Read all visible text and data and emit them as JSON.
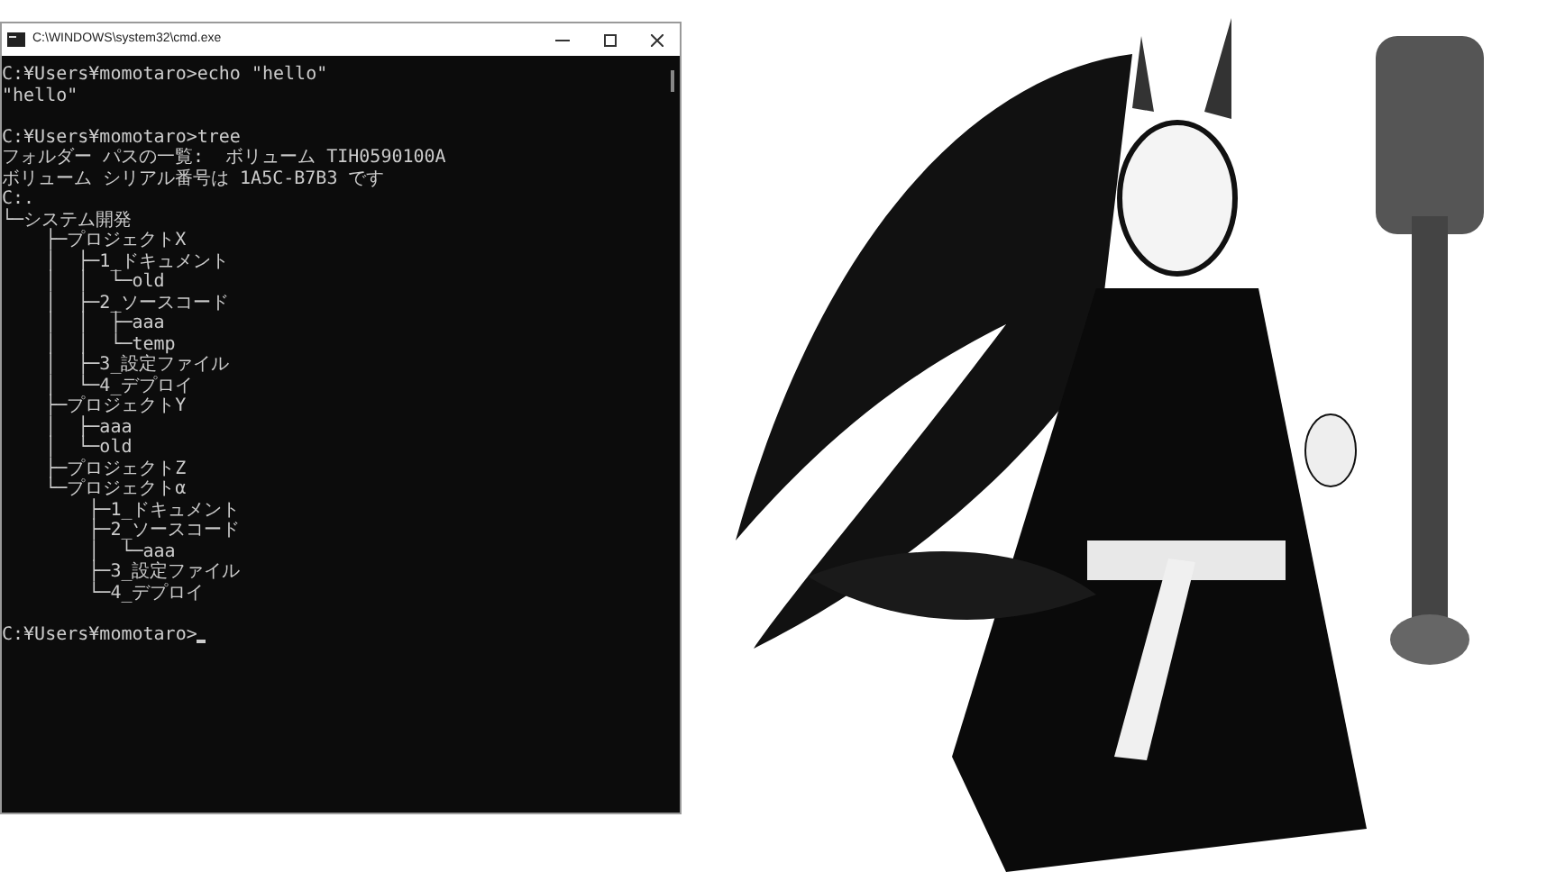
{
  "window": {
    "title": "C:\\WINDOWS\\system32\\cmd.exe"
  },
  "console": {
    "blocks": [
      [
        "C:¥Users¥momotaro>echo \"hello\"",
        "\"hello\""
      ],
      [
        "C:¥Users¥momotaro>tree",
        "フォルダー パスの一覧:  ボリューム TIH0590100A",
        "ボリューム シリアル番号は 1A5C-B7B3 です",
        "C:.",
        "└─システム開発",
        "    ├─プロジェクトX",
        "    │  ├─1_ドキュメント",
        "    │  │  └─old",
        "    │  ├─2_ソースコード",
        "    │  │  ├─aaa",
        "    │  │  └─temp",
        "    │  ├─3_設定ファイル",
        "    │  └─4_デプロイ",
        "    ├─プロジェクトY",
        "    │  ├─aaa",
        "    │  └─old",
        "    ├─プロジェクトZ",
        "    └─プロジェクトα",
        "        ├─1_ドキュメント",
        "        ├─2_ソースコード",
        "        │  └─aaa",
        "        ├─3_設定ファイル",
        "        └─4_デプロイ"
      ],
      [
        "C:¥Users¥momotaro>"
      ]
    ],
    "cursor": true
  }
}
